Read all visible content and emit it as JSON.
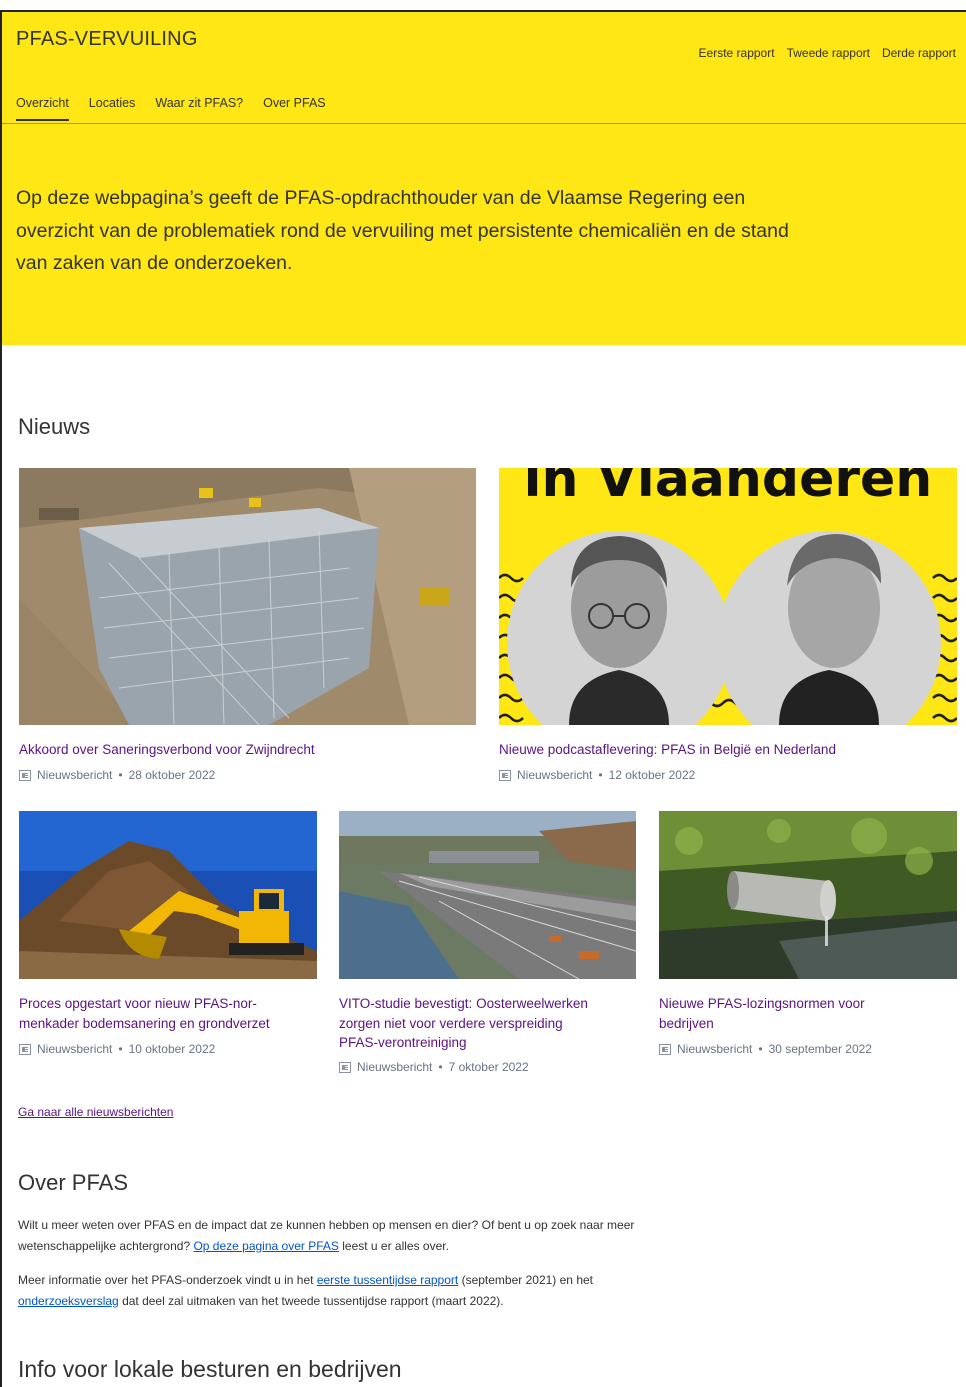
{
  "header": {
    "brand": "PFAS-VERVUILING",
    "top_links": [
      "Eerste rapport",
      "Tweede rapport",
      "Derde rapport"
    ],
    "tabs": [
      "Overzicht",
      "Locaties",
      "Waar zit PFAS?",
      "Over PFAS"
    ],
    "active_tab": "Overzicht"
  },
  "intro": "Op deze webpagina’s geeft de PFAS-opdrachthouder van de Vlaamse Regering een overzicht van de problematiek rond de vervuiling met persistente chemicaliën en de stand van zaken van de onderzoeken.",
  "news": {
    "heading": "Nieuws",
    "items": [
      {
        "title": "Akkoord over Saneringsverbond voor Zwijndrecht",
        "type": "Nieuwsbericht",
        "date": "28 oktober 2022",
        "image": "construction-site-aerial"
      },
      {
        "title": "Nieuwe podcastaflevering: PFAS in België en Nederland",
        "type": "Nieuwsbericht",
        "date": "12 oktober 2022",
        "image": "podcast-portraits",
        "image_text": "in Vlaanderen"
      },
      {
        "title": "Proces opgestart voor nieuw PFAS-nor-menkader bodemsanering en grondverzet",
        "title_lines": [
          "Proces opgestart voor nieuw PFAS-nor-",
          "menkader bodemsanering en grondverzet"
        ],
        "type": "Nieuwsbericht",
        "date": "10 oktober 2022",
        "image": "excavator-soil-heap"
      },
      {
        "title": "VITO-studie bevestigt: Oosterweelwerken zorgen niet voor verdere verspreiding PFAS-verontreiniging",
        "title_lines": [
          "VITO-studie bevestigt: Oosterweelwerken",
          "zorgen niet voor verdere verspreiding",
          "PFAS-verontreiniging"
        ],
        "type": "Nieuwsbericht",
        "date": "7 oktober 2022",
        "image": "highway-aerial"
      },
      {
        "title": "Nieuwe PFAS-lozingsnormen voor bedrijven",
        "title_lines": [
          "Nieuwe PFAS-lozingsnormen voor",
          "bedrijven"
        ],
        "type": "Nieuwsbericht",
        "date": "30 september 2022",
        "image": "discharge-pipe"
      }
    ],
    "all_link": "Ga naar alle nieuwsberichten"
  },
  "over_pfas": {
    "heading": "Over PFAS",
    "p1": {
      "before": "Wilt u meer weten over PFAS en de impact dat ze kunnen hebben op mensen en dier? Of bent u op zoek naar meer wetenschappelijke achtergrond? ",
      "link": "Op deze pagina over PFAS",
      "after": " leest u er alles over."
    },
    "p2": {
      "before": "Meer informatie over het PFAS-onderzoek vindt u in het ",
      "link1": "eerste tussentijdse rapport",
      "middle": " (september 2021) en het ",
      "link2": "onderzoeksverslag",
      "after": " dat deel zal uitmaken van het tweede tussentijdse rapport (maart 2022)."
    }
  },
  "info": {
    "heading": "Info voor lokale besturen en bedrijven"
  },
  "colors": {
    "hero_yellow": "#ffe615",
    "link_purple": "#5a1380",
    "link_blue": "#0055cc",
    "text_dark": "#333332"
  }
}
